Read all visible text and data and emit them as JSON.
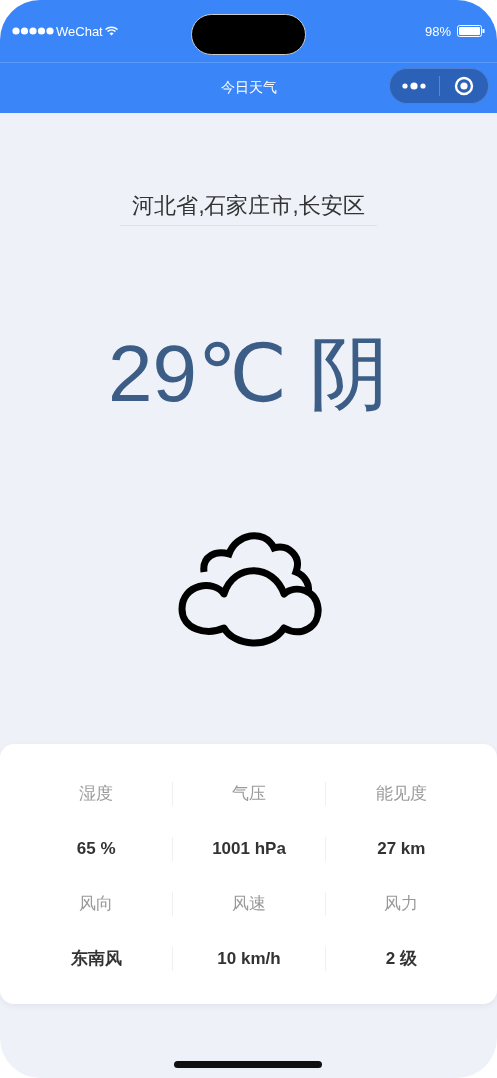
{
  "status_bar": {
    "carrier": "WeChat",
    "battery": "98%"
  },
  "nav": {
    "title": "今日天气"
  },
  "location": "河北省,石家庄市,长安区",
  "weather": {
    "temperature": "29℃",
    "condition": "阴"
  },
  "stat_groups": [
    [
      {
        "label": "湿度",
        "value": "65 %"
      },
      {
        "label": "气压",
        "value": "1001 hPa"
      },
      {
        "label": "能见度",
        "value": "27 km"
      }
    ],
    [
      {
        "label": "风向",
        "value": "东南风"
      },
      {
        "label": "风速",
        "value": "10 km/h"
      },
      {
        "label": "风力",
        "value": "2 级"
      }
    ]
  ]
}
